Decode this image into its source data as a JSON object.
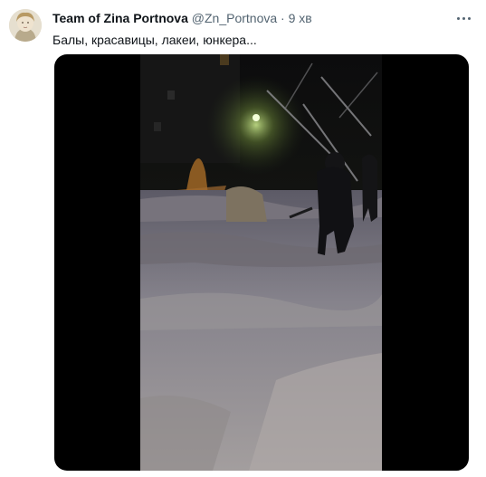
{
  "tweet": {
    "author_name": "Team of Zina Portnova",
    "author_handle": "@Zn_Portnova",
    "separator": "·",
    "time": "9 хв",
    "text": "Балы, красавицы, лакеи, юнкера..."
  },
  "icons": {
    "more": "more-horizontal-icon"
  },
  "media": {
    "type": "video"
  }
}
